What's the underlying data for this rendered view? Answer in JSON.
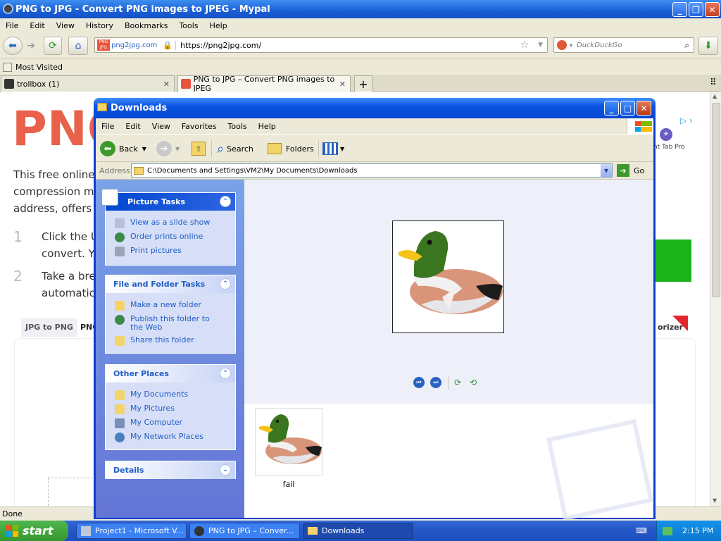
{
  "browser": {
    "window_title": "PNG to JPG - Convert PNG images to JPEG - Mypal",
    "menu": [
      "File",
      "Edit",
      "View",
      "History",
      "Bookmarks",
      "Tools",
      "Help"
    ],
    "site_identity": "png2jpg.com",
    "url": "https://png2jpg.com/",
    "search_placeholder": "DuckDuckGo",
    "bookmarks_toolbar": "Most Visited",
    "tabs": [
      {
        "label": "trollbox (1)"
      },
      {
        "label": "PNG to JPG – Convert PNG images to JPEG"
      }
    ],
    "status": "Done"
  },
  "page": {
    "heading": "PNG",
    "para_lines": [
      "This free online",
      "compression me",
      "address, offers"
    ],
    "steps": [
      {
        "num": "1",
        "lines": [
          "Click the U",
          "convert. Y"
        ]
      },
      {
        "num": "2",
        "lines": [
          "Take a bre",
          "automatica"
        ]
      }
    ],
    "tabs_left": [
      "JPG to PNG",
      "PNG"
    ],
    "tab_right": "orizer",
    "ad_text": "nt Tab Pro"
  },
  "explorer": {
    "title": "Downloads",
    "menu": [
      "File",
      "Edit",
      "View",
      "Favorites",
      "Tools",
      "Help"
    ],
    "toolbar": {
      "back": "Back",
      "search": "Search",
      "folders": "Folders"
    },
    "address_label": "Address",
    "address": "C:\\Documents and Settings\\VM2\\My Documents\\Downloads",
    "go": "Go",
    "panels": {
      "picture_tasks": {
        "title": "Picture Tasks",
        "items": [
          "View as a slide show",
          "Order prints online",
          "Print pictures"
        ]
      },
      "file_folder_tasks": {
        "title": "File and Folder Tasks",
        "items": [
          "Make a new folder",
          "Publish this folder to the Web",
          "Share this folder"
        ]
      },
      "other_places": {
        "title": "Other Places",
        "items": [
          "My Documents",
          "My Pictures",
          "My Computer",
          "My Network Places"
        ]
      },
      "details": {
        "title": "Details"
      }
    },
    "file": {
      "name": "fail"
    }
  },
  "taskbar": {
    "start": "start",
    "items": [
      "Project1 - Microsoft V...",
      "PNG to JPG – Conver...",
      "Downloads"
    ],
    "clock": "2:15 PM"
  }
}
